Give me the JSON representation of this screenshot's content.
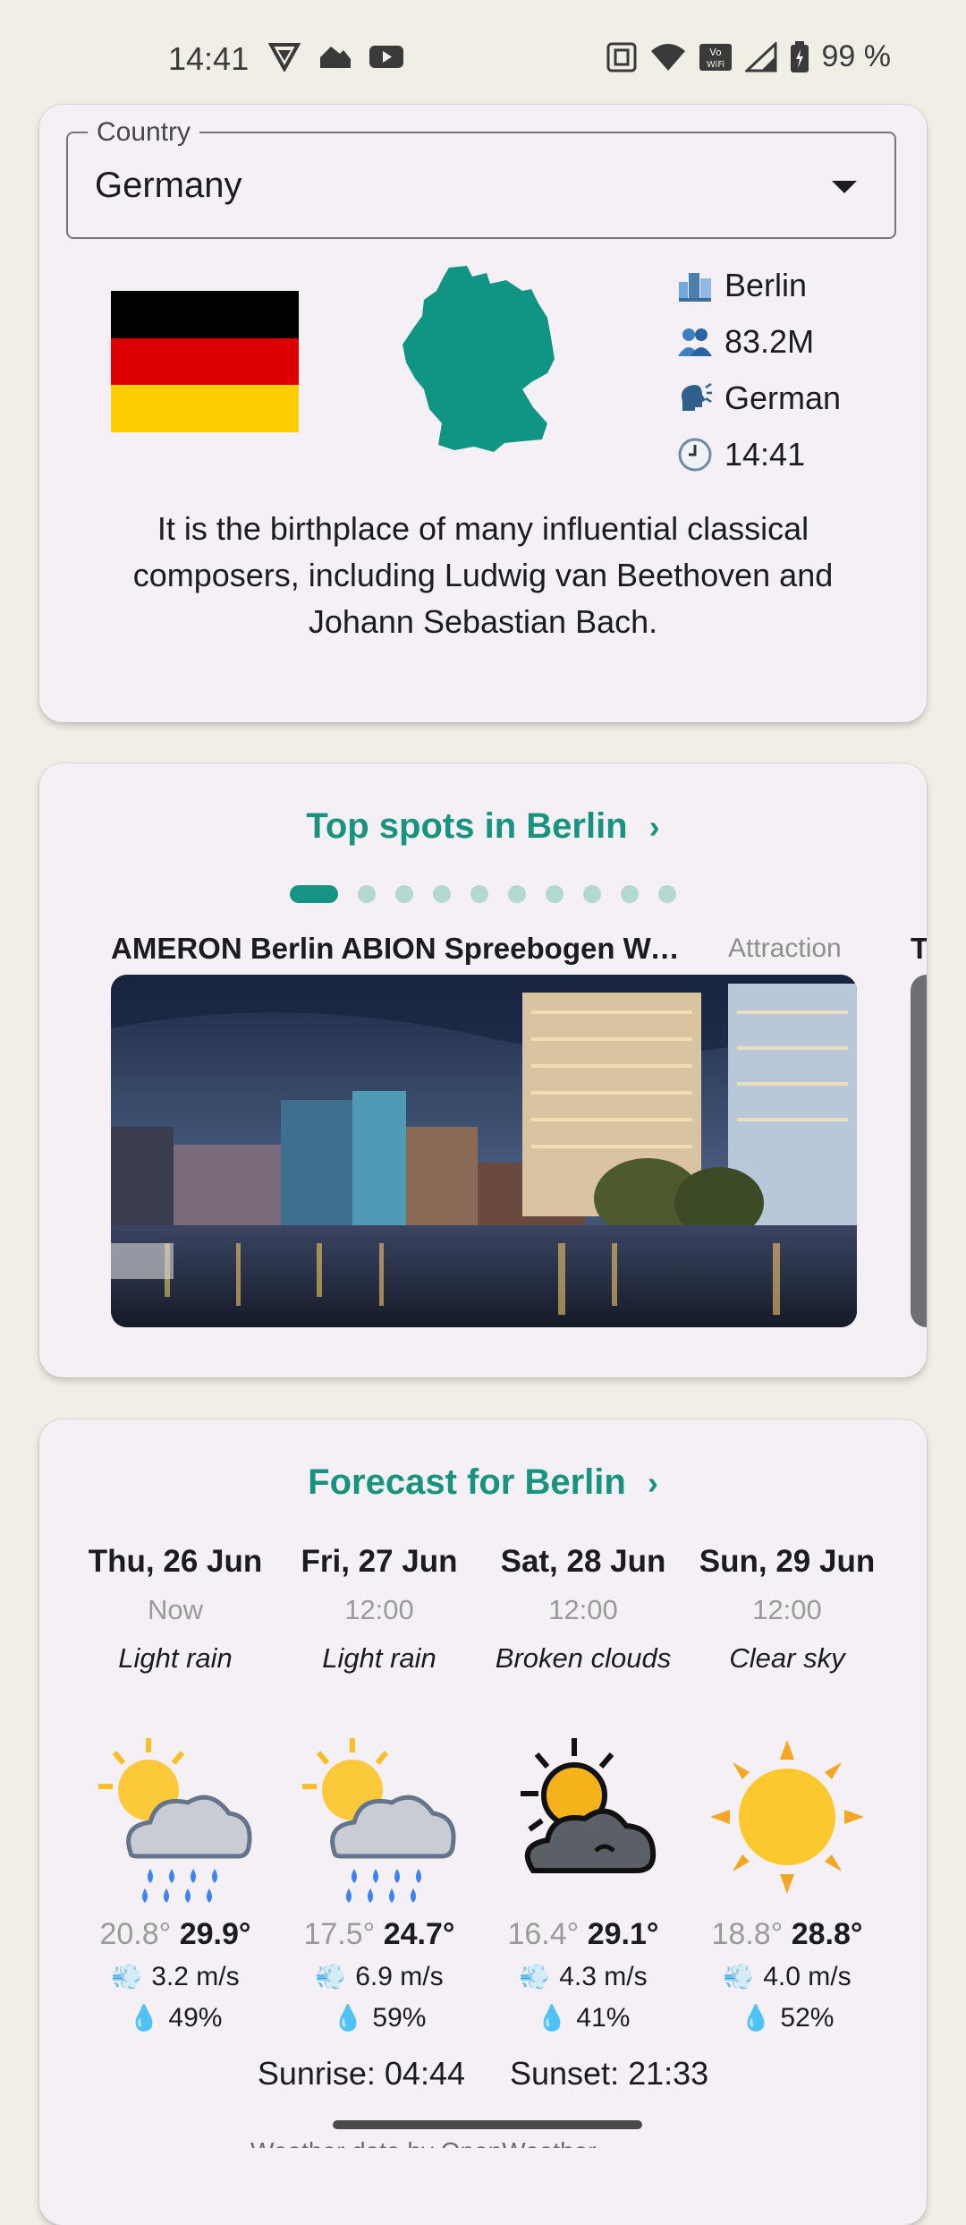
{
  "status": {
    "time": "14:41",
    "battery": "99 %",
    "left_icons": [
      "vpn-shield-icon",
      "smart-home-icon",
      "youtube-icon"
    ],
    "right_icons": [
      "nfc-icon",
      "wifi-icon",
      "vowifi-icon",
      "signal-icon",
      "battery-icon"
    ]
  },
  "country_card": {
    "field_label": "Country",
    "selected_country": "Germany",
    "flag_colors": [
      "#000000",
      "#dd0000",
      "#ffce00"
    ],
    "map_color": "#109484",
    "facts": [
      {
        "icon": "cityscape-icon",
        "value": "Berlin"
      },
      {
        "icon": "people-icon",
        "value": "83.2M"
      },
      {
        "icon": "speaking-head-icon",
        "value": "German"
      },
      {
        "icon": "clock-icon",
        "value": "14:41"
      }
    ],
    "fun_fact": "It is the birthplace of many influential classical composers, including Ludwig van Beethoven and Johann Sebastian Bach."
  },
  "spots_card": {
    "heading": "Top spots in Berlin",
    "chevron": "›",
    "page_count": 10,
    "active_page": 0,
    "spots": [
      {
        "title": "AMERON Berlin ABION Spreebogen Waterside Hotel",
        "type": "Attraction"
      },
      {
        "title": "T",
        "type": ""
      }
    ]
  },
  "forecast_card": {
    "heading": "Forecast for Berlin",
    "chevron": "›",
    "days": [
      {
        "date": "Thu, 26 Jun",
        "time": "Now",
        "desc": "Light rain",
        "icon": "sun-rain-cloud-icon",
        "low": "20.8°",
        "high": "29.9°",
        "wind": "3.2 m/s",
        "humidity": "49%"
      },
      {
        "date": "Fri, 27 Jun",
        "time": "12:00",
        "desc": "Light rain",
        "icon": "sun-rain-cloud-icon",
        "low": "17.5°",
        "high": "24.7°",
        "wind": "6.9 m/s",
        "humidity": "59%"
      },
      {
        "date": "Sat, 28 Jun",
        "time": "12:00",
        "desc": "Broken clouds",
        "icon": "sun-dark-cloud-icon",
        "low": "16.4°",
        "high": "29.1°",
        "wind": "4.3 m/s",
        "humidity": "41%"
      },
      {
        "date": "Sun, 29 Jun",
        "time": "12:00",
        "desc": "Clear sky",
        "icon": "sun-icon",
        "low": "18.8°",
        "high": "28.8°",
        "wind": "4.0 m/s",
        "humidity": "52%"
      }
    ],
    "sunrise": "Sunrise: 04:44",
    "sunset": "Sunset: 21:33",
    "footer_partial": "Weather data by OpenWeather"
  },
  "colors": {
    "accent": "#17937f",
    "card_bg": "#f4f0f6",
    "page_bg": "#f1eee6"
  }
}
